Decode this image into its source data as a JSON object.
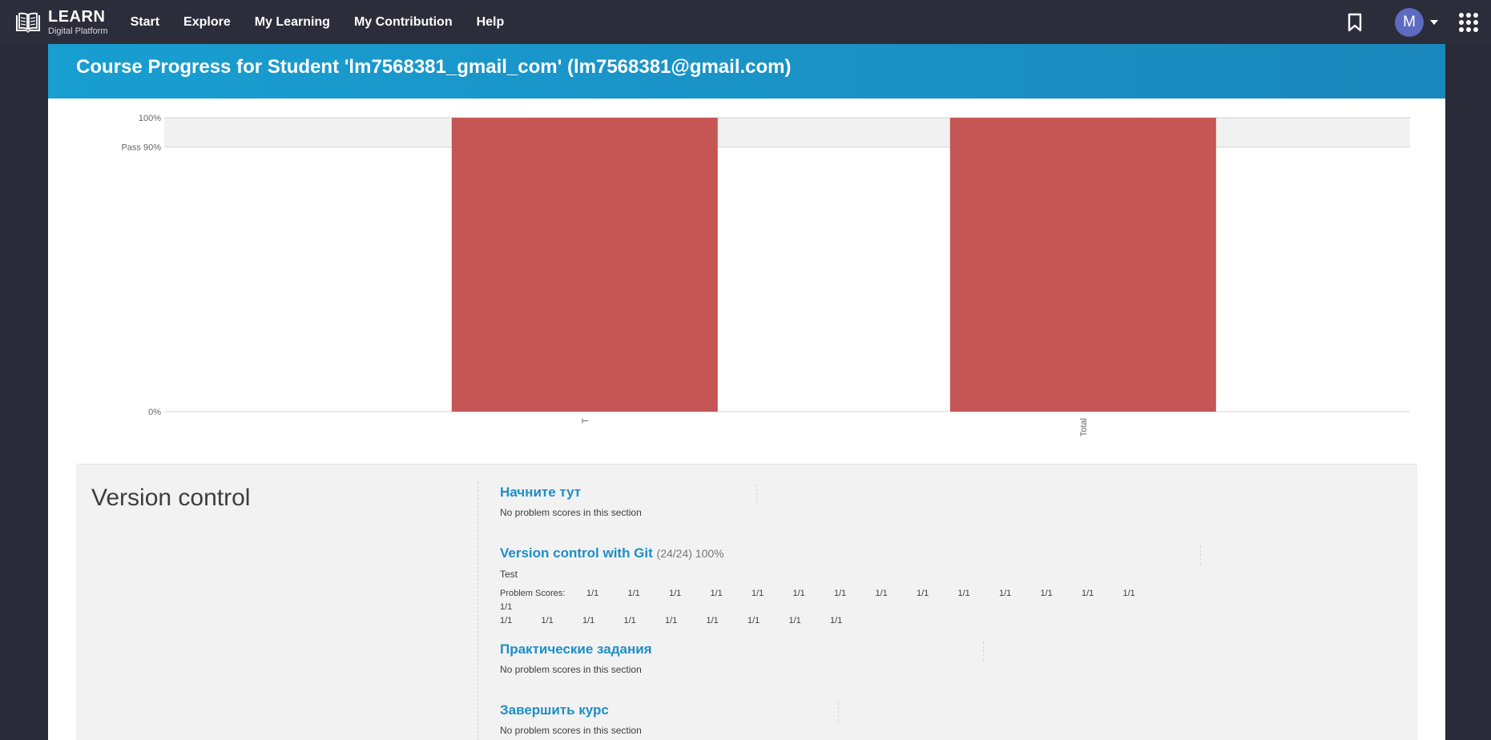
{
  "nav": {
    "logo_main": "LEARN",
    "logo_sub": "Digital Platform",
    "links": [
      "Start",
      "Explore",
      "My Learning",
      "My Contribution",
      "Help"
    ],
    "avatar_initial": "M"
  },
  "banner": {
    "title": "Course Progress for Student 'lm7568381_gmail_com' (lm7568381@gmail.com)"
  },
  "chart_data": {
    "type": "bar",
    "categories": [
      "T",
      "Total"
    ],
    "values": [
      100,
      100
    ],
    "ylim": [
      0,
      100
    ],
    "y_ticks": [
      {
        "value": 100,
        "label": "100%"
      },
      {
        "value": 90,
        "label": "Pass 90%"
      },
      {
        "value": 0,
        "label": "0%"
      }
    ],
    "pass_threshold": 90,
    "bar_color": "#c44e4e",
    "grid": true
  },
  "section": {
    "title": "Version control",
    "subsections": [
      {
        "title": "Начните тут",
        "score": "",
        "note": "No problem scores in this section"
      },
      {
        "title": "Version control with Git",
        "score": "(24/24) 100%",
        "test_label": "Test",
        "problem_scores_label": "Problem Scores:",
        "scores": [
          "1/1",
          "1/1",
          "1/1",
          "1/1",
          "1/1",
          "1/1",
          "1/1",
          "1/1",
          "1/1",
          "1/1",
          "1/1",
          "1/1",
          "1/1",
          "1/1",
          "1/1",
          "1/1",
          "1/1",
          "1/1",
          "1/1",
          "1/1",
          "1/1",
          "1/1",
          "1/1",
          "1/1"
        ]
      },
      {
        "title": "Практические задания",
        "score": "",
        "note": "No problem scores in this section"
      },
      {
        "title": "Завершить курс",
        "score": "",
        "note": "No problem scores in this section"
      }
    ]
  }
}
